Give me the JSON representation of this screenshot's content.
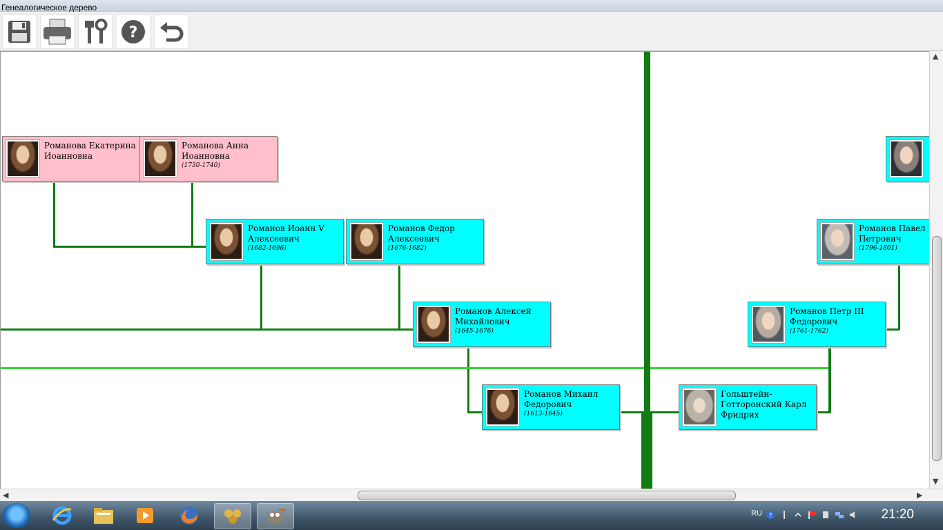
{
  "window": {
    "title": "Генеалогическое дерево"
  },
  "toolbar": [
    {
      "id": "save",
      "icon": "save-icon"
    },
    {
      "id": "print",
      "icon": "printer-icon"
    },
    {
      "id": "settings",
      "icon": "tools-icon"
    },
    {
      "id": "help",
      "icon": "help-icon"
    },
    {
      "id": "undo",
      "icon": "undo-icon"
    }
  ],
  "persons": [
    {
      "id": "ekaterina",
      "name": "Романова Екатерина Иоанновна",
      "years": "",
      "gender": "female"
    },
    {
      "id": "anna",
      "name": "Романова Анна Иоанновна",
      "years": "(1730-1740)",
      "gender": "female"
    },
    {
      "id": "ioann",
      "name": "Романов Иоанн V Алексеевич",
      "years": "(1682-1696)",
      "gender": "male"
    },
    {
      "id": "fedor",
      "name": "Романов Федор Алексеевич",
      "years": "(1676-1682)",
      "gender": "male"
    },
    {
      "id": "aleksei",
      "name": "Романов Алексей Михайлович",
      "years": "(1645-1676)",
      "gender": "male"
    },
    {
      "id": "mikhail",
      "name": "Романов Михаил Федорович",
      "years": "(1613-1645)",
      "gender": "male"
    },
    {
      "id": "karl",
      "name": "Гольштейн-Готторонский Карл Фридрих",
      "years": "",
      "gender": "male"
    },
    {
      "id": "petr3",
      "name": "Романов Петр III Федорович",
      "years": "(1761-1762)",
      "gender": "male"
    },
    {
      "id": "pavel",
      "name": "Романов Павел I Петрович",
      "years": "(1796-1801)",
      "gender": "male"
    }
  ],
  "taskbar": {
    "language": "RU",
    "clock": "21:20",
    "apps": [
      "internet-explorer-icon",
      "explorer-folder-icon",
      "media-player-icon",
      "firefox-icon",
      "genealogy-app-icon",
      "gimp-icon"
    ]
  }
}
